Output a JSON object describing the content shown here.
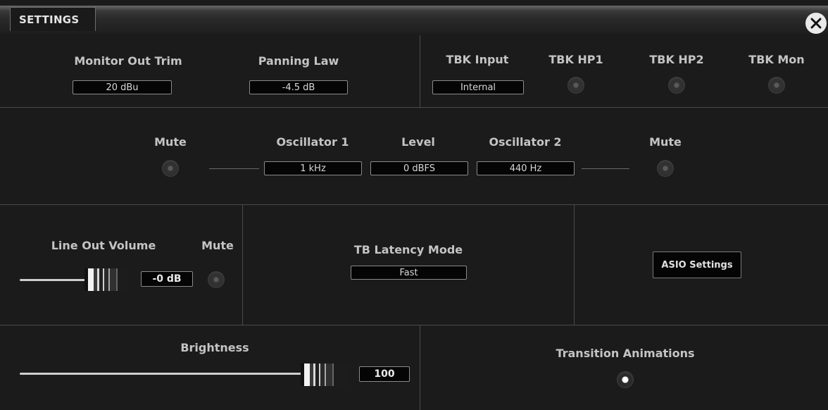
{
  "window": {
    "title": "SETTINGS",
    "close_icon": "close-icon"
  },
  "monitor": {
    "trim_label": "Monitor Out Trim",
    "trim_value": "20 dBu",
    "panning_label": "Panning Law",
    "panning_value": "-4.5 dB"
  },
  "talkback": {
    "input_label": "TBK Input",
    "input_value": "Internal",
    "hp1_label": "TBK HP1",
    "hp2_label": "TBK HP2",
    "mon_label": "TBK Mon"
  },
  "oscillator": {
    "mute1_label": "Mute",
    "osc1_label": "Oscillator 1",
    "osc1_value": "1 kHz",
    "level_label": "Level",
    "level_value": "0 dBFS",
    "osc2_label": "Oscillator 2",
    "osc2_value": "440 Hz",
    "mute2_label": "Mute"
  },
  "line_out": {
    "volume_label": "Line Out Volume",
    "volume_value": "-0 dB",
    "mute_label": "Mute"
  },
  "latency": {
    "label": "TB Latency Mode",
    "value": "Fast"
  },
  "asio": {
    "button_label": "ASIO Settings"
  },
  "brightness": {
    "label": "Brightness",
    "value": "100"
  },
  "animations": {
    "label": "Transition Animations",
    "enabled": true
  }
}
